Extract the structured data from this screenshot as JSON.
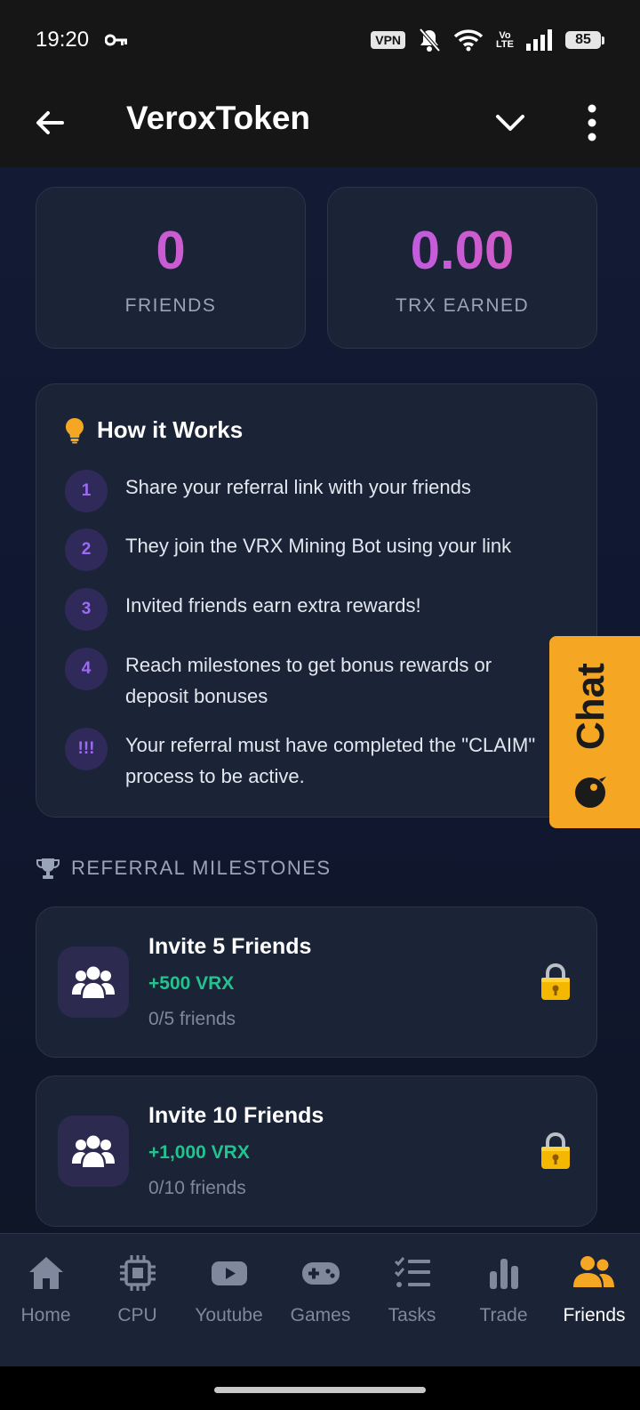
{
  "status_bar": {
    "time": "19:20",
    "vpn_label": "VPN",
    "volte_line1": "Vo",
    "volte_line2": "LTE",
    "battery": "85"
  },
  "app_bar": {
    "title": "VeroxToken"
  },
  "stats": {
    "friends_value": "0",
    "friends_label": "FRIENDS",
    "earned_value": "0.00",
    "earned_label": "TRX EARNED"
  },
  "how_it_works": {
    "title": "How it Works",
    "steps": [
      {
        "badge": "1",
        "text": "Share your referral link with your friends"
      },
      {
        "badge": "2",
        "text": "They join the VRX Mining Bot using your link"
      },
      {
        "badge": "3",
        "text": "Invited friends earn extra rewards!"
      },
      {
        "badge": "4",
        "text": "Reach milestones to get bonus rewards or deposit bonuses"
      },
      {
        "badge": "!!!",
        "text": "Your referral must have completed the \"CLAIM\" process to be active."
      }
    ]
  },
  "chat_tab": {
    "label": "Chat"
  },
  "milestones": {
    "heading": "REFERRAL MILESTONES",
    "items": [
      {
        "title": "Invite 5 Friends",
        "reward": "+500 VRX",
        "progress": "0/5 friends"
      },
      {
        "title": "Invite 10 Friends",
        "reward": "+1,000 VRX",
        "progress": "0/10 friends"
      }
    ]
  },
  "bottom_nav": {
    "items": [
      {
        "label": "Home",
        "icon": "home-icon"
      },
      {
        "label": "CPU",
        "icon": "cpu-icon"
      },
      {
        "label": "Youtube",
        "icon": "youtube-icon"
      },
      {
        "label": "Games",
        "icon": "gamepad-icon"
      },
      {
        "label": "Tasks",
        "icon": "tasks-icon"
      },
      {
        "label": "Trade",
        "icon": "bar-chart-icon"
      },
      {
        "label": "Friends",
        "icon": "friends-icon"
      }
    ],
    "active": "Friends"
  },
  "colors": {
    "accent_orange": "#f5a623",
    "reward_green": "#22c38e",
    "purple_gradient_start": "#b45cf0",
    "purple_gradient_end": "#e05cb4"
  }
}
